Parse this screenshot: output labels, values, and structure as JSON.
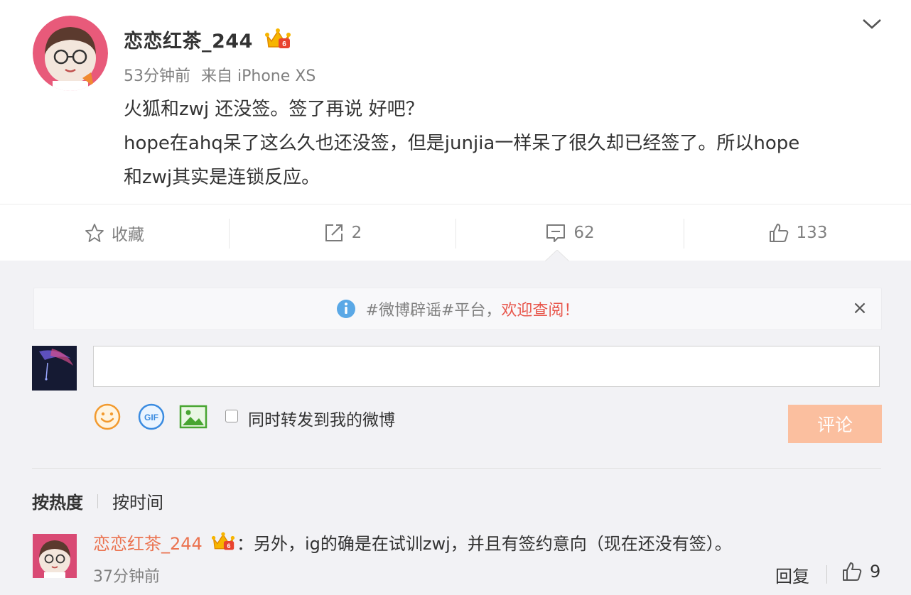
{
  "post": {
    "username": "恋恋红茶_244",
    "time": "53分钟前",
    "source": "来自 iPhone XS",
    "lines": [
      "火狐和zwj 还没签。签了再说 好吧？",
      "hope在ahq呆了这么久也还没签，但是junjia一样呆了很久却已经签了。所以hope",
      "和zwj其实是连锁反应。"
    ],
    "icons": {
      "more": "chevron-down-icon",
      "vip": "vip-crown-badge"
    }
  },
  "actions": {
    "favorite_label": "收藏",
    "repost_count": "2",
    "comment_count": "62",
    "like_count": "133"
  },
  "notice": {
    "prefix": "#微博辟谣#平台，",
    "highlight": "欢迎查阅！",
    "highlight_color": "#e8554a",
    "close_symbol": "×"
  },
  "composer": {
    "input_value": "",
    "repost_checkbox_label": "同时转发到我的微博",
    "submit_label": "评论",
    "submit_color": "#fbbf9f",
    "tools": [
      "emoji-icon",
      "gif-icon",
      "image-icon"
    ]
  },
  "sort": {
    "active": "按热度",
    "inactive": "按时间"
  },
  "comment": {
    "username": "恋恋红茶_244",
    "text": "：另外，ig的确是在试训zwj，并且有签约意向（现在还没有签）。",
    "time": "37分钟前",
    "reply_label": "回复",
    "like_count": "9",
    "name_color": "#eb7350"
  }
}
